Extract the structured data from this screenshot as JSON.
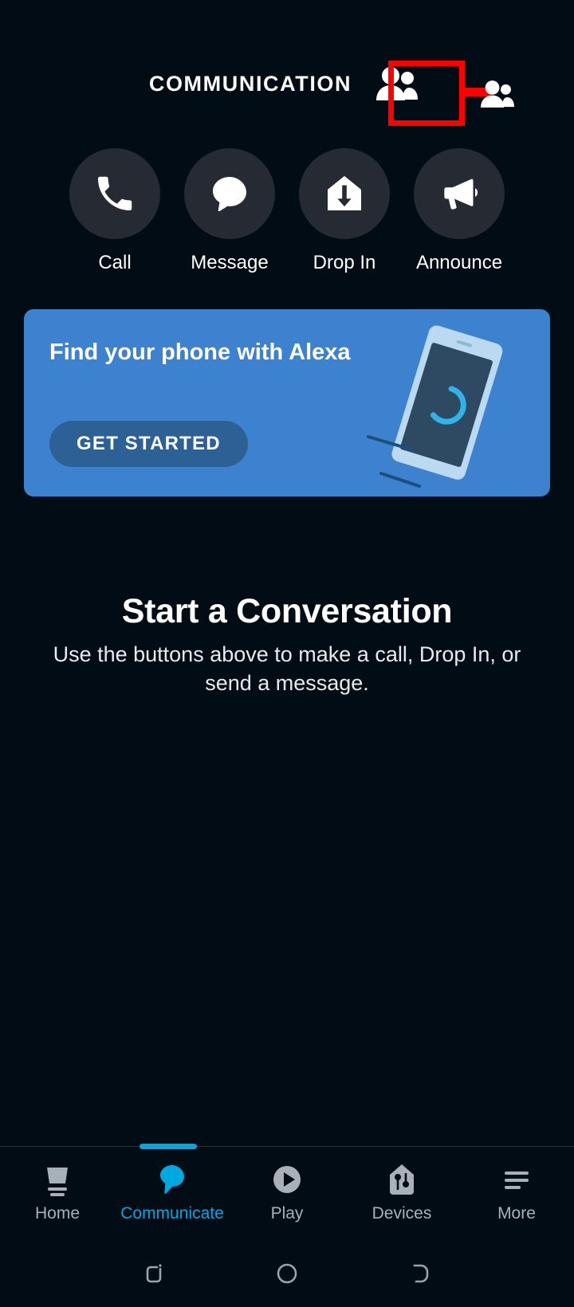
{
  "header": {
    "title": "COMMUNICATION",
    "contacts_icon": "contacts-people-icon"
  },
  "annotation": {
    "box_color": "#ff0000",
    "target": "contacts-people-icon"
  },
  "actions": [
    {
      "label": "Call",
      "icon": "phone-icon"
    },
    {
      "label": "Message",
      "icon": "speech-bubble-icon"
    },
    {
      "label": "Drop In",
      "icon": "house-down-arrow-icon"
    },
    {
      "label": "Announce",
      "icon": "megaphone-icon"
    }
  ],
  "promo": {
    "title": "Find your phone with Alexa",
    "cta_label": "GET STARTED",
    "card_color": "#3c82ce",
    "cta_color": "#2d6196",
    "art": "tilted-phone-with-alexa-ring"
  },
  "empty_state": {
    "title": "Start a Conversation",
    "subtitle": "Use the buttons above to make a call,\nDrop In, or send a message."
  },
  "tabbar": {
    "active_color": "#00a8e1",
    "inactive_color": "#a9b1b8",
    "items": [
      {
        "label": "Home",
        "icon": "home-device-icon",
        "active": false
      },
      {
        "label": "Communicate",
        "icon": "speech-bubble-icon",
        "active": true
      },
      {
        "label": "Play",
        "icon": "play-circle-icon",
        "active": false
      },
      {
        "label": "Devices",
        "icon": "devices-house-icon",
        "active": false
      },
      {
        "label": "More",
        "icon": "hamburger-menu-icon",
        "active": false
      }
    ]
  },
  "system_nav": [
    {
      "name": "recents-button"
    },
    {
      "name": "home-button"
    },
    {
      "name": "back-button"
    }
  ]
}
